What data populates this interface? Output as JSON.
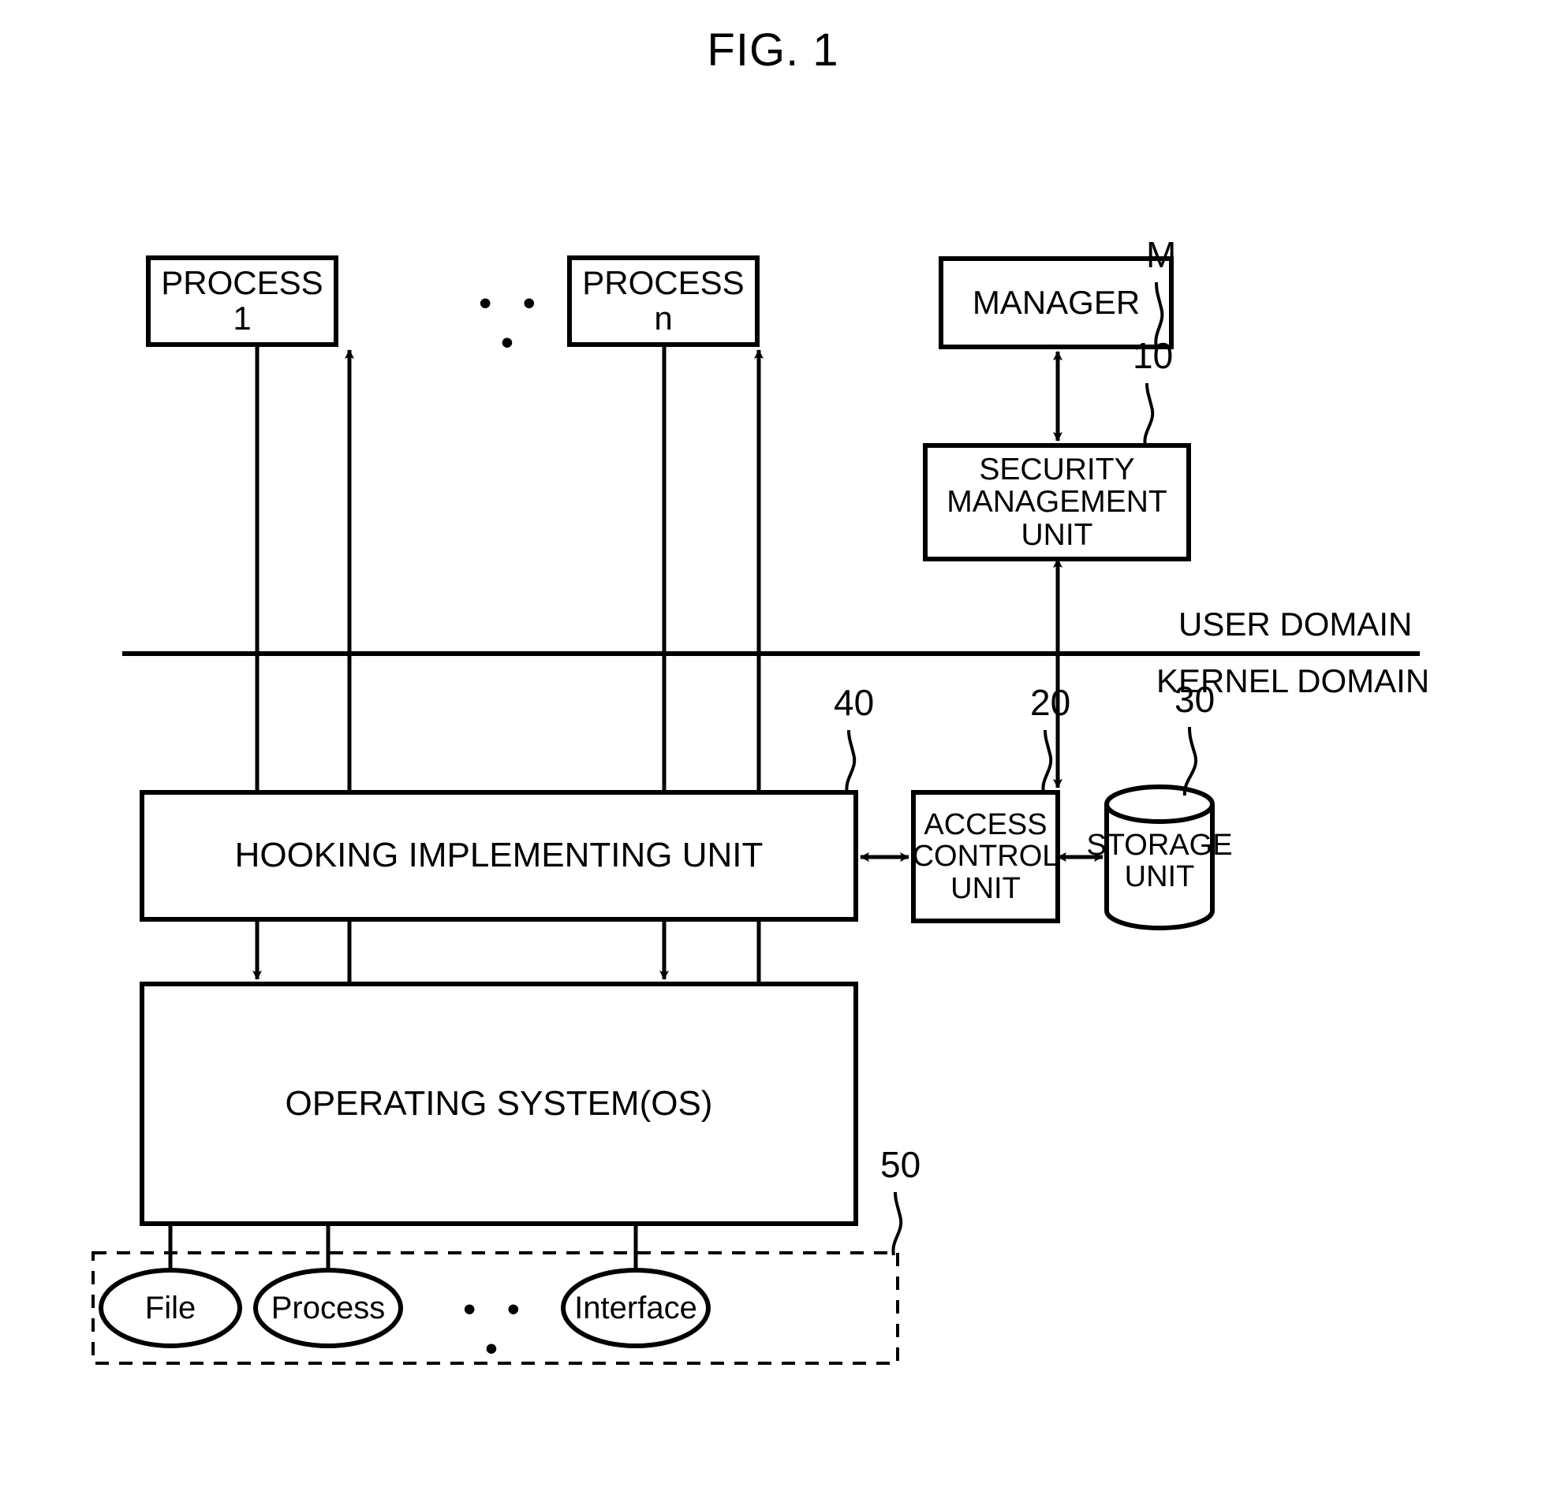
{
  "figure": {
    "title": "FIG. 1"
  },
  "boxes": {
    "process_1": "PROCESS 1",
    "process_n": "PROCESS n",
    "manager": "MANAGER",
    "security_management_unit": "SECURITY\nMANAGEMENT\nUNIT",
    "hooking_implementing_unit": "HOOKING IMPLEMENTING UNIT",
    "access_control_unit": "ACCESS\nCONTROL\nUNIT",
    "storage_unit": "STORAGE\nUNIT",
    "operating_system": "OPERATING SYSTEM(OS)"
  },
  "resources": {
    "file": "File",
    "process": "Process",
    "interface": "Interface",
    "ellipsis": "• • •"
  },
  "ellipsis_top": "• • •",
  "domains": {
    "user": "USER DOMAIN",
    "kernel": "KERNEL DOMAIN"
  },
  "ref_numerals": {
    "manager": "M",
    "security_management_unit": "10",
    "access_control_unit": "20",
    "storage_unit": "30",
    "hooking_implementing_unit": "40",
    "resources_group": "50"
  },
  "style": {
    "stroke": "#000000",
    "background": "#ffffff"
  }
}
